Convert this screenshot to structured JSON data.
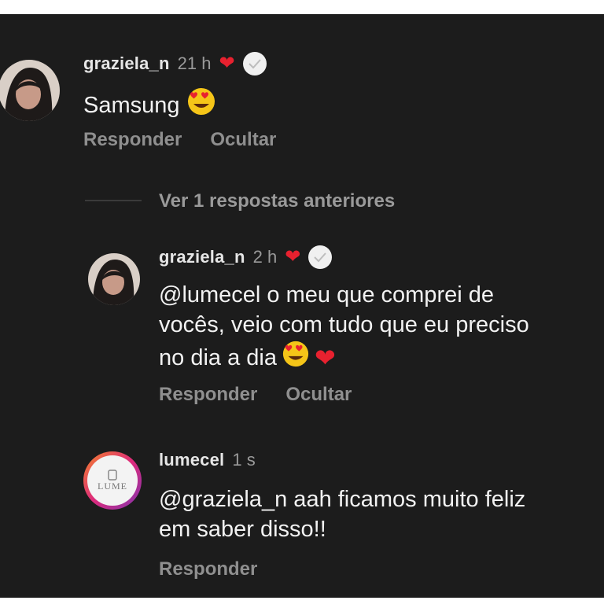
{
  "comments": [
    {
      "username": "graziela_n",
      "time": "21 h",
      "text": "Samsung",
      "reply_label": "Responder",
      "hide_label": "Ocultar"
    },
    {
      "username": "graziela_n",
      "time": "2 h",
      "text_lines": [
        "@lumecel o meu que comprei de",
        "vocês,  veio com tudo que eu preciso",
        "no dia a dia"
      ],
      "reply_label": "Responder",
      "hide_label": "Ocultar"
    },
    {
      "username": "lumecel",
      "time": "1 s",
      "avatar_text": "LUME",
      "text_lines": [
        "@graziela_n aah ficamos muito feliz",
        "em saber disso!!"
      ],
      "reply_label": "Responder"
    }
  ],
  "view_earlier": "Ver 1 respostas anteriores",
  "icons": {
    "heart": "heart-icon",
    "emoji": "heart-eyes-emoji-icon",
    "verified": "verified-badge-icon"
  },
  "colors": {
    "background": "#1c1c1c",
    "heart": "#e8212f",
    "emoji": "#f5c518",
    "lumecel_ring": "#e0448a"
  }
}
